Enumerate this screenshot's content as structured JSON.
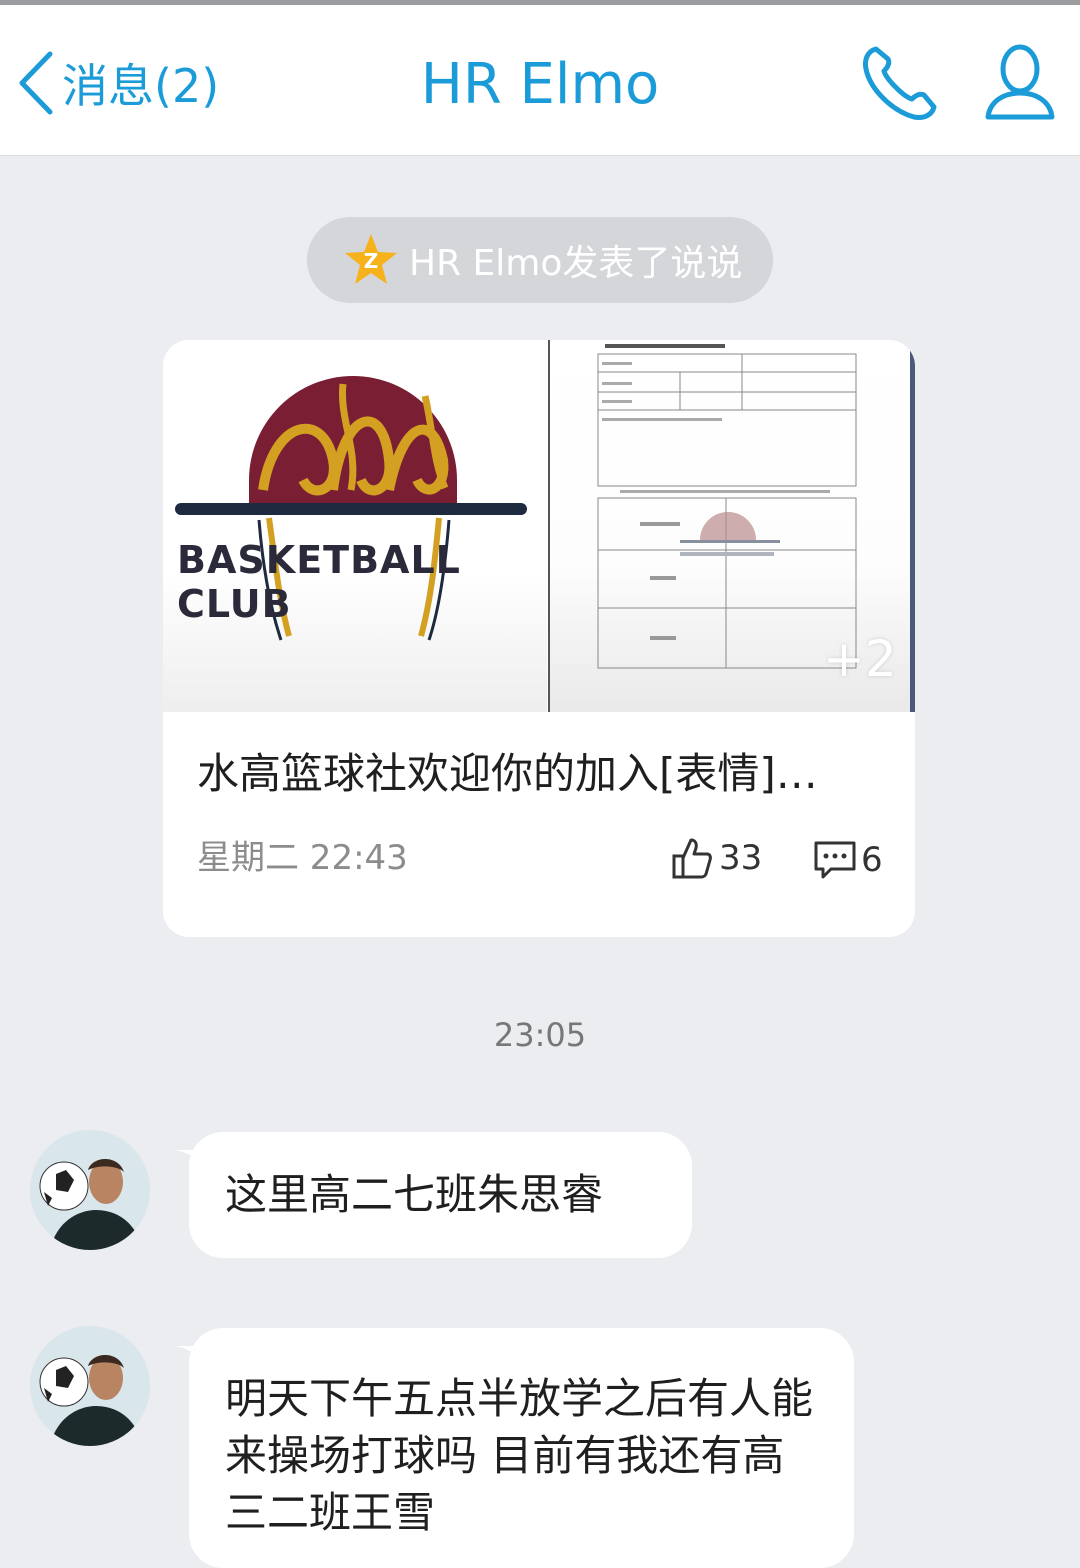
{
  "nav": {
    "back_label": "消息(2)",
    "title": "HR Elmo"
  },
  "notice": {
    "text": "HR Elmo发表了说说"
  },
  "post": {
    "image_left_text": "BASKETBALL CLUB",
    "more_images": "+2",
    "text": "水高篮球社欢迎你的加入[表情]…",
    "time": "星期二 22:43",
    "likes": "33",
    "comments": "6"
  },
  "chat": {
    "timestamp": "23:05",
    "messages": [
      {
        "text": "这里高二七班朱思睿"
      },
      {
        "text": "明天下午五点半放学之后有人能来操场打球吗 目前有我还有高三二班王雪"
      }
    ]
  },
  "colors": {
    "accent": "#1b9bd8",
    "background": "#ebedf1"
  }
}
